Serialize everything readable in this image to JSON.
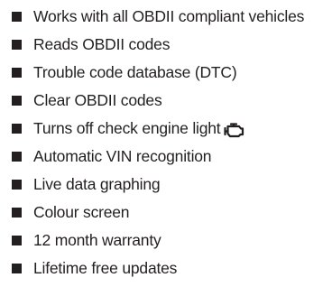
{
  "features": [
    {
      "label": "Works with all OBDII compliant vehicles"
    },
    {
      "label": "Reads OBDII codes"
    },
    {
      "label": "Trouble code database (DTC)"
    },
    {
      "label": "Clear OBDII codes"
    },
    {
      "label": "Turns off check engine light",
      "icon": "check-engine-icon"
    },
    {
      "label": "Automatic VIN recognition"
    },
    {
      "label": "Live data graphing"
    },
    {
      "label": "Colour screen"
    },
    {
      "label": "12 month warranty"
    },
    {
      "label": "Lifetime free updates"
    }
  ],
  "colors": {
    "text": "#231f20",
    "bullet": "#231f20"
  }
}
